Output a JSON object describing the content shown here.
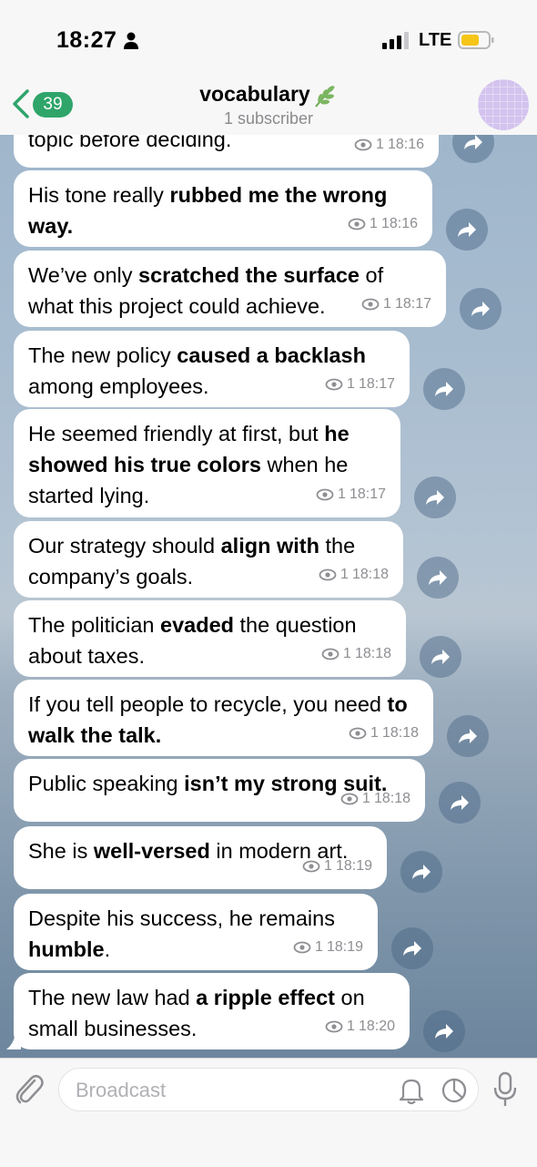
{
  "status_bar": {
    "time": "18:27",
    "network": "LTE"
  },
  "header": {
    "back_count": "39",
    "title": "vocabulary",
    "subtitle": "1 subscriber"
  },
  "messages": [
    {
      "parts": [
        {
          "t": "topic before deciding.",
          "b": false
        }
      ],
      "views": "1",
      "time": "18:16"
    },
    {
      "parts": [
        {
          "t": "His tone really ",
          "b": false
        },
        {
          "t": "rubbed me the wrong way.",
          "b": true
        }
      ],
      "views": "1",
      "time": "18:16"
    },
    {
      "parts": [
        {
          "t": "We’ve only ",
          "b": false
        },
        {
          "t": "scratched the surface",
          "b": true
        },
        {
          "t": " of what this project could achieve.",
          "b": false
        }
      ],
      "views": "1",
      "time": "18:17"
    },
    {
      "parts": [
        {
          "t": "The new policy ",
          "b": false
        },
        {
          "t": "caused a backlash",
          "b": true
        },
        {
          "t": " among employees.",
          "b": false
        }
      ],
      "views": "1",
      "time": "18:17"
    },
    {
      "parts": [
        {
          "t": "He seemed friendly at first, but ",
          "b": false
        },
        {
          "t": "he showed his true colors",
          "b": true
        },
        {
          "t": " when he started lying.",
          "b": false
        }
      ],
      "views": "1",
      "time": "18:17"
    },
    {
      "parts": [
        {
          "t": "Our strategy should ",
          "b": false
        },
        {
          "t": "align with",
          "b": true
        },
        {
          "t": " the company’s goals.",
          "b": false
        }
      ],
      "views": "1",
      "time": "18:18"
    },
    {
      "parts": [
        {
          "t": "The politician ",
          "b": false
        },
        {
          "t": "evaded",
          "b": true
        },
        {
          "t": " the question about taxes.",
          "b": false
        }
      ],
      "views": "1",
      "time": "18:18"
    },
    {
      "parts": [
        {
          "t": "If you tell people to recycle, you need ",
          "b": false
        },
        {
          "t": "to walk the talk.",
          "b": true
        }
      ],
      "views": "1",
      "time": "18:18"
    },
    {
      "parts": [
        {
          "t": "Public speaking ",
          "b": false
        },
        {
          "t": "isn’t my strong suit.",
          "b": true
        }
      ],
      "views": "1",
      "time": "18:18"
    },
    {
      "parts": [
        {
          "t": "She is ",
          "b": false
        },
        {
          "t": "well-versed",
          "b": true
        },
        {
          "t": " in modern art.",
          "b": false
        }
      ],
      "views": "1",
      "time": "18:19"
    },
    {
      "parts": [
        {
          "t": "Despite his success, he remains ",
          "b": false
        },
        {
          "t": "humble",
          "b": true
        },
        {
          "t": ".",
          "b": false
        }
      ],
      "views": "1",
      "time": "18:19"
    },
    {
      "parts": [
        {
          "t": "The new law had ",
          "b": false
        },
        {
          "t": "a ripple effect",
          "b": true
        },
        {
          "t": " on small businesses.",
          "b": false
        }
      ],
      "views": "1",
      "time": "18:20"
    }
  ],
  "input": {
    "placeholder": "Broadcast"
  },
  "icons": [
    "person-icon",
    "signal-icon",
    "battery-icon",
    "back-chevron-icon",
    "leaf-icon",
    "eye-icon",
    "forward-icon",
    "paperclip-icon",
    "bell-icon",
    "timer-icon",
    "microphone-icon"
  ],
  "colors": {
    "accent": "#2fa56a",
    "badge": "#2fa56a",
    "battery": "#f5c518",
    "avatar": "#d3c3ee"
  }
}
